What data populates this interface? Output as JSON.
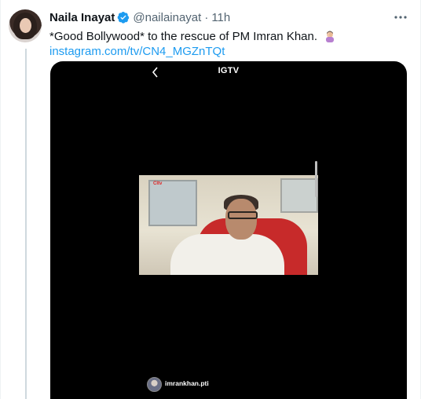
{
  "tweet": {
    "author_name": "Naila Inayat",
    "handle": "@nailainayat",
    "separator": "·",
    "time": "11h",
    "text": "*Good Bollywood* to the rescue of PM Imran Khan.",
    "emoji": "woman-facepalming-emoji",
    "link": "instagram.com/tv/CN4_MGZnTQt"
  },
  "media": {
    "title": "IGTV",
    "video_logo": "Cltv",
    "account": "imrankhan.pti"
  },
  "colors": {
    "link": "#1d9bf0",
    "verified": "#1d9bf0",
    "secondary_text": "#536471",
    "media_background": "#000000"
  },
  "icons": [
    "verified-badge-icon",
    "more-icon",
    "back-chevron-icon",
    "facepalm-emoji-icon"
  ]
}
